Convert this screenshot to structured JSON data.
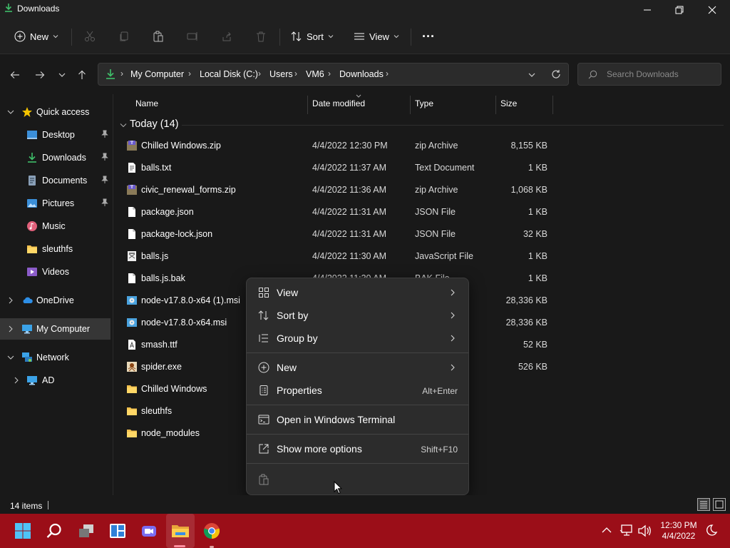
{
  "window": {
    "title": "Downloads",
    "minimize_label": "—",
    "maximize_label": "❐",
    "close_label": "✕"
  },
  "toolbar": {
    "new_label": "New",
    "sort_label": "Sort",
    "view_label": "View",
    "more_label": "···"
  },
  "address": {
    "crumbs": [
      "My Computer",
      "Local Disk (C:)",
      "Users",
      "VM6",
      "Downloads"
    ],
    "crumb_sep": "›"
  },
  "search": {
    "placeholder": "Search Downloads"
  },
  "sidebar": {
    "quick_access": "Quick access",
    "items": [
      {
        "label": "Desktop",
        "icon": "desktop-icon",
        "pinned": true
      },
      {
        "label": "Downloads",
        "icon": "download-icon",
        "pinned": true
      },
      {
        "label": "Documents",
        "icon": "documents-icon",
        "pinned": true
      },
      {
        "label": "Pictures",
        "icon": "pictures-icon",
        "pinned": true
      },
      {
        "label": "Music",
        "icon": "music-icon",
        "pinned": false
      },
      {
        "label": "sleuthfs",
        "icon": "folder-icon",
        "pinned": false
      },
      {
        "label": "Videos",
        "icon": "videos-icon",
        "pinned": false
      }
    ],
    "onedrive": "OneDrive",
    "my_computer": "My Computer",
    "network": "Network",
    "ad": "AD"
  },
  "columns": {
    "name": "Name",
    "date": "Date modified",
    "type": "Type",
    "size": "Size"
  },
  "group": {
    "label": "Today (14)"
  },
  "files": [
    {
      "name": "Chilled Windows.zip",
      "date": "4/4/2022 12:30 PM",
      "type": "zip Archive",
      "size": "8,155 KB",
      "icon": "zip-icon"
    },
    {
      "name": "balls.txt",
      "date": "4/4/2022 11:37 AM",
      "type": "Text Document",
      "size": "1 KB",
      "icon": "text-file-icon"
    },
    {
      "name": "civic_renewal_forms.zip",
      "date": "4/4/2022 11:36 AM",
      "type": "zip Archive",
      "size": "1,068 KB",
      "icon": "zip-icon"
    },
    {
      "name": "package.json",
      "date": "4/4/2022 11:31 AM",
      "type": "JSON File",
      "size": "1 KB",
      "icon": "file-icon"
    },
    {
      "name": "package-lock.json",
      "date": "4/4/2022 11:31 AM",
      "type": "JSON File",
      "size": "32 KB",
      "icon": "file-icon"
    },
    {
      "name": "balls.js",
      "date": "4/4/2022 11:30 AM",
      "type": "JavaScript File",
      "size": "1 KB",
      "icon": "script-icon"
    },
    {
      "name": "balls.js.bak",
      "date": "4/4/2022 11:30 AM",
      "type": "BAK File",
      "size": "1 KB",
      "icon": "file-icon"
    },
    {
      "name": "node-v17.8.0-x64 (1).msi",
      "date": "",
      "type": "ller ...",
      "size": "28,336 KB",
      "icon": "installer-icon"
    },
    {
      "name": "node-v17.8.0-x64.msi",
      "date": "",
      "type": "ller ...",
      "size": "28,336 KB",
      "icon": "installer-icon"
    },
    {
      "name": "smash.ttf",
      "date": "",
      "type": "file",
      "size": "52 KB",
      "icon": "font-icon"
    },
    {
      "name": "spider.exe",
      "date": "",
      "type": "",
      "size": "526 KB",
      "icon": "exe-icon"
    },
    {
      "name": "Chilled Windows",
      "date": "",
      "type": "",
      "size": "",
      "icon": "folder-icon"
    },
    {
      "name": "sleuthfs",
      "date": "",
      "type": "",
      "size": "",
      "icon": "folder-icon"
    },
    {
      "name": "node_modules",
      "date": "",
      "type": "",
      "size": "",
      "icon": "folder-icon"
    }
  ],
  "context_menu": {
    "view": "View",
    "sort_by": "Sort by",
    "group_by": "Group by",
    "new": "New",
    "properties": "Properties",
    "properties_shortcut": "Alt+Enter",
    "open_terminal": "Open in Windows Terminal",
    "show_more": "Show more options",
    "show_more_shortcut": "Shift+F10"
  },
  "status": {
    "count": "14 items"
  },
  "taskbar": {
    "time": "12:30 PM",
    "date": "4/4/2022",
    "color": "#9b0e18"
  }
}
